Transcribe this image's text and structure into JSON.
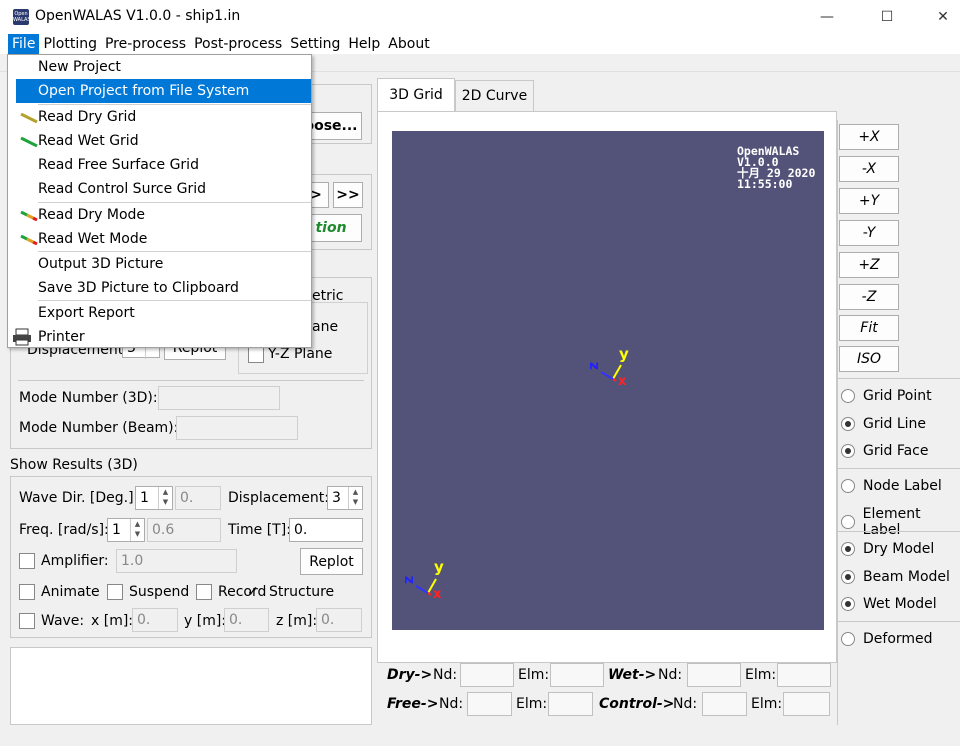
{
  "window": {
    "title": "OpenWALAS V1.0.0 - ship1.in",
    "icon": "openwalas-app-icon",
    "minimize": "—",
    "maximize": "☐",
    "close": "✕"
  },
  "menubar": [
    "File",
    "Plotting",
    "Pre-process",
    "Post-process",
    "Setting",
    "Help",
    "About"
  ],
  "file_menu": {
    "items": [
      {
        "label": "New Project"
      },
      {
        "label": "Open Project from File System"
      },
      {
        "label": "Read Dry Grid",
        "icon": "yellow-line-icon"
      },
      {
        "label": "Read Wet Grid",
        "icon": "green-line-icon"
      },
      {
        "label": "Read Free Surface Grid"
      },
      {
        "label": "Read Control Surce Grid"
      },
      {
        "label": "Read Dry Mode",
        "icon": "mode-line-icon"
      },
      {
        "label": "Read Wet Mode",
        "icon": "mode-line-icon"
      },
      {
        "label": "Output 3D Picture"
      },
      {
        "label": "Save 3D Picture to Clipboard"
      },
      {
        "label": "Export Report"
      },
      {
        "label": "Printer",
        "icon": "printer-icon"
      }
    ]
  },
  "left": {
    "choose_button": "oose...",
    "nav_prev": ">",
    "nav_next": ">>",
    "animation_button": "tion",
    "metric_label": "etric",
    "plane_label": "ane",
    "displacement_label": "Displacement",
    "displacement_value": "3",
    "replot_small": "Replot",
    "yz_plane": "Y-Z Plane",
    "mode_number_3d": "Mode Number (3D):",
    "mode_number_beam": "Mode Number (Beam):",
    "show_results": "Show Results (3D)",
    "wave_dir_label": "Wave Dir. [Deg.]:",
    "wave_dir_value": "1",
    "wave_dir_field": "0.",
    "disp_label": "Displacement:",
    "disp_value": "3",
    "freq_label": "Freq. [rad/s]:",
    "freq_value": "1",
    "freq_field": "0.6",
    "time_label": "Time [T]:",
    "time_value": "0.",
    "amplifier_label": "Amplifier:",
    "amplifier_value": "1.0",
    "replot": "Replot",
    "animate": "Animate",
    "suspend": "Suspend",
    "record": "Record",
    "structure": "Structure",
    "wave_label": "Wave:",
    "x_label": "x [m]:",
    "x_value": "0.",
    "y_label": "y [m]:",
    "y_value": "0.",
    "z_label": "z [m]:",
    "z_value": "0."
  },
  "tabs": [
    "3D Grid",
    "2D Curve"
  ],
  "viewport": {
    "bg": "#535379",
    "stamp": [
      "OpenWALAS",
      "V1.0.0",
      "十月 29 2020",
      "11:55:00"
    ],
    "axis_x": "x",
    "axis_y": "y",
    "axis_z": "z"
  },
  "side": {
    "buttons": [
      "+X",
      "-X",
      "+Y",
      "-Y",
      "+Z",
      "-Z",
      "Fit",
      "ISO"
    ],
    "radios": [
      {
        "label": "Grid Point",
        "on": false
      },
      {
        "label": "Grid Line",
        "on": true
      },
      {
        "label": "Grid Face",
        "on": true
      },
      {
        "label": "Node Label",
        "on": false
      },
      {
        "label": "Element Label",
        "on": false
      },
      {
        "label": "Dry Model",
        "on": true
      },
      {
        "label": "Beam Model",
        "on": true
      },
      {
        "label": "Wet Model",
        "on": true
      },
      {
        "label": "Deformed",
        "on": false
      }
    ]
  },
  "bottom": {
    "dry": "Dry->",
    "wet": "Wet->",
    "free": "Free->",
    "control": "Control->",
    "nd": "Nd:",
    "elm": "Elm:"
  }
}
